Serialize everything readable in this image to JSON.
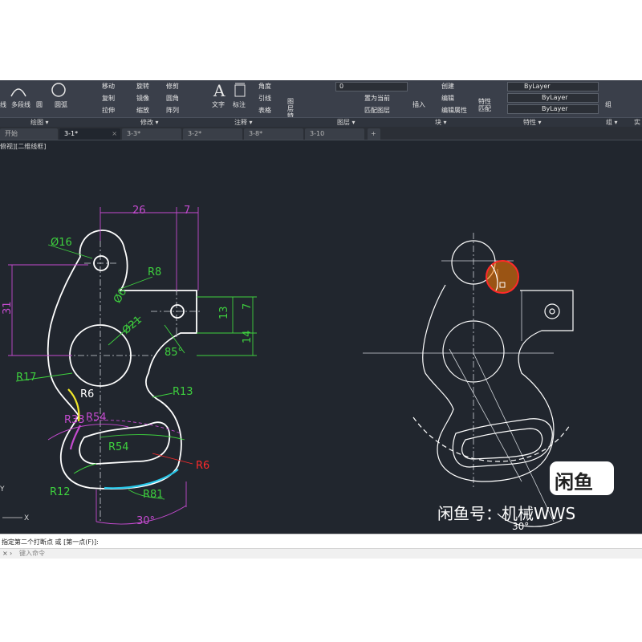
{
  "ribbon": {
    "draw_items": [
      "线",
      "多段线",
      "圆",
      "圆弧"
    ],
    "modify_items": [
      "移动",
      "旋转",
      "修剪",
      "复制",
      "镜像",
      "圆角",
      "拉伸",
      "缩放",
      "阵列"
    ],
    "annotation_items": [
      "文字",
      "标注",
      "角度",
      "引线",
      "表格"
    ],
    "layer_items": [
      "图层特性",
      "置为当前",
      "匹配图层"
    ],
    "layer_current": "0",
    "block_items": [
      "插入",
      "创建",
      "编辑",
      "编辑属性"
    ],
    "properties_items": [
      "特性匹配"
    ],
    "bylayer_1": "ByLayer",
    "bylayer_2": "ByLayer",
    "bylayer_3": "ByLayer",
    "group_label": "组",
    "panel_titles": [
      "绘图 ▾",
      "修改 ▾",
      "注释 ▾",
      "图层 ▾",
      "块 ▾",
      "特性 ▾",
      "组 ▾",
      "实"
    ]
  },
  "tabs": [
    {
      "label": "开始",
      "active": false
    },
    {
      "label": "3-1*",
      "active": true
    },
    {
      "label": "3-3*",
      "active": false
    },
    {
      "label": "3-2*",
      "active": false
    },
    {
      "label": "3-8*",
      "active": false
    },
    {
      "label": "3-10",
      "active": false
    }
  ],
  "tab_add": "+",
  "viewport_label": "俯视][二维线框]",
  "dimensions": {
    "d26": "26",
    "d7": "7",
    "dia16": "Ø16",
    "r8": "R8",
    "dia6": "Ø6",
    "dia21": "Ø21",
    "d31": "31",
    "d13": "13",
    "d7b": "7",
    "d14": "14",
    "ang85": "85°",
    "r17": "R17",
    "r6a": "R6",
    "r13": "R13",
    "r33": "R33",
    "r54a": "R54",
    "r54b": "R54",
    "r6b": "R6",
    "r12": "R12",
    "r81": "R81",
    "ang30": "30°",
    "ang30b": "30°"
  },
  "ucs": {
    "y": "Y",
    "x": "X"
  },
  "command": {
    "history": "指定第二个打断点 或 [第一点(F)]:",
    "placeholder": "键入命令"
  },
  "watermark": {
    "logo": "闲鱼",
    "text": "闲鱼号：机械WWS"
  },
  "colors": {
    "canvas": "#21262e",
    "geometry": "#ffffff",
    "dimension_green": "#3ed13e",
    "dimension_magenta": "#c54bd0",
    "accent_red": "#ff2a2a",
    "accent_yellow": "#f2e82a",
    "accent_cyan": "#27c6e8",
    "highlight_orange": "#ff7a00"
  }
}
